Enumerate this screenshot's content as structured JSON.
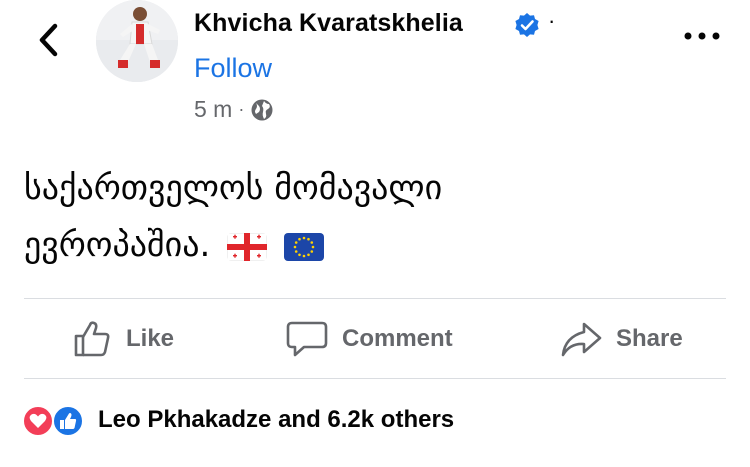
{
  "post": {
    "author": "Khvicha Kvaratskhelia",
    "follow_label": "Follow",
    "time": "5 m",
    "separator": "·",
    "text_line1": "საქართველოს მომავალი",
    "text_line2": "ევროპაშია."
  },
  "actions": {
    "like_label": "Like",
    "comment_label": "Comment",
    "share_label": "Share"
  },
  "reactions": {
    "summary": "Leo Pkhakadze and 6.2k others"
  },
  "colors": {
    "accent": "#1b74e4",
    "love": "#f33e58",
    "muted_text": "#65676b",
    "divider": "#dadde1"
  },
  "icons": [
    "back-arrow-icon",
    "verified-badge-icon",
    "globe-icon",
    "more-options-icon",
    "like-icon",
    "comment-icon",
    "share-icon",
    "love-reaction-icon",
    "like-reaction-icon",
    "georgia-flag-icon",
    "eu-flag-icon"
  ]
}
